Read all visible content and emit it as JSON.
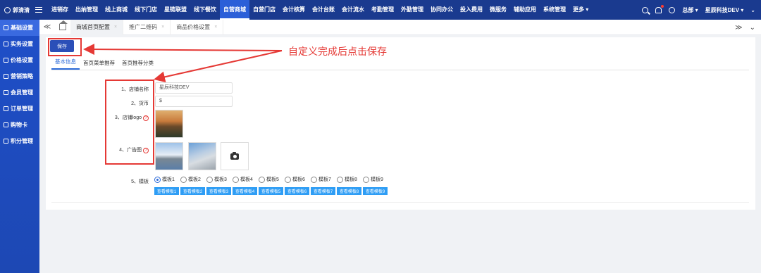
{
  "topbar": {
    "user_name": "郭清清",
    "menu": [
      "进销存",
      "出纳管理",
      "线上商城",
      "线下门店",
      "星链联盟",
      "线下餐饮",
      "自营商城",
      "自营门店",
      "会计核算",
      "会计台账",
      "会计流水",
      "考勤管理",
      "外勤管理",
      "协同办公",
      "投入费用",
      "微服务",
      "辅助应用",
      "系统管理",
      "更多 ▾"
    ],
    "active_menu_index": 6,
    "right": {
      "org": "总部 ▾",
      "company": "星辰科技DEV ▾",
      "more": "⌄"
    }
  },
  "sidebar": {
    "items": [
      "基础设置",
      "实务设置",
      "价格设置",
      "营销策略",
      "会员管理",
      "订单管理",
      "购物卡",
      "积分管理"
    ],
    "active_index": 0
  },
  "tabbar": {
    "tabs": [
      "商城首页配置",
      "推广二维码",
      "商品价格设置"
    ],
    "active_index": 0,
    "close_glyph": "×",
    "collapse_glyph": "≪",
    "expand_glyph": "≫",
    "down_glyph": "⌄"
  },
  "content": {
    "save_label": "保存",
    "annotation": "自定义完成后点击保存",
    "subtabs": [
      "基本信息",
      "首页菜单推荐",
      "首页推荐分类"
    ],
    "active_subtab": 0,
    "fields": {
      "store_name_label": "1、店铺名称",
      "store_name_value": "星辰科技DEV",
      "currency_label": "2、货币",
      "currency_value": "$",
      "logo_label": "3、店铺logo",
      "ad_label": "4、广告图",
      "template_label": "5、模板",
      "help_glyph": "?"
    },
    "templates": [
      "模板1",
      "模板2",
      "模板3",
      "模板4",
      "模板5",
      "模板6",
      "模板7",
      "模板8",
      "模板9"
    ],
    "selected_template": 0,
    "view_buttons": [
      "查看模板1",
      "查看模板2",
      "查看模板3",
      "查看模板4",
      "查看模板5",
      "查看模板6",
      "查看模板7",
      "查看模板8",
      "查看模板9"
    ]
  },
  "colors": {
    "nav": "#1a3a8f",
    "sidebar": "#1f4fc8",
    "accent": "#2b6ad8",
    "annotation": "#e53935",
    "view_button": "#2e9df5"
  }
}
